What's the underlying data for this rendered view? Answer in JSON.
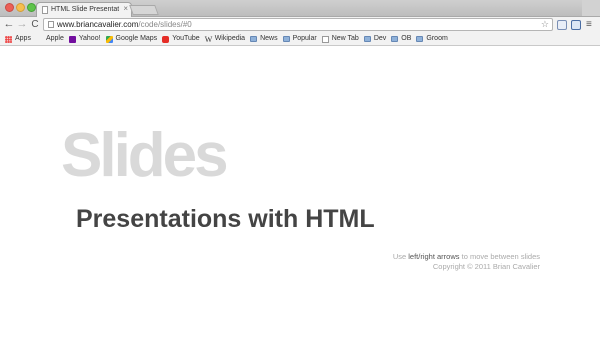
{
  "browser": {
    "tab": {
      "title": "HTML Slide Presentation",
      "close_glyph": "×"
    },
    "toolbar": {
      "back_glyph": "←",
      "forward_glyph": "→",
      "reload_glyph": "C",
      "url_host": "www.briancavalier.com",
      "url_path": "/code/slides/#0",
      "star_glyph": "☆",
      "menu_glyph": "≡"
    },
    "bookmarks": [
      {
        "label": "Apps",
        "icon": "apps-icon"
      },
      {
        "label": "Apple",
        "icon": "apple-icon"
      },
      {
        "label": "Yahoo!",
        "icon": "yahoo-icon"
      },
      {
        "label": "Google Maps",
        "icon": "maps-icon"
      },
      {
        "label": "YouTube",
        "icon": "youtube-icon"
      },
      {
        "label": "Wikipedia",
        "icon": "wikipedia-icon"
      },
      {
        "label": "News",
        "icon": "folder-icon"
      },
      {
        "label": "Popular",
        "icon": "folder-icon"
      },
      {
        "label": "New Tab",
        "icon": "page-icon"
      },
      {
        "label": "Dev",
        "icon": "folder-icon"
      },
      {
        "label": "OB",
        "icon": "folder-icon"
      },
      {
        "label": "Groom",
        "icon": "folder-icon"
      }
    ]
  },
  "slide": {
    "watermark": "Slides",
    "headline": "Presentations with HTML",
    "help_prefix": "Use ",
    "help_keys": "left/right arrows",
    "help_suffix": " to move between slides",
    "copyright": "Copyright © 2011 Brian Cavalier"
  },
  "colors": {
    "watermark": "#d9d9d9",
    "headline": "#444444",
    "muted_text": "#aaaaaa",
    "key_text": "#555555"
  }
}
